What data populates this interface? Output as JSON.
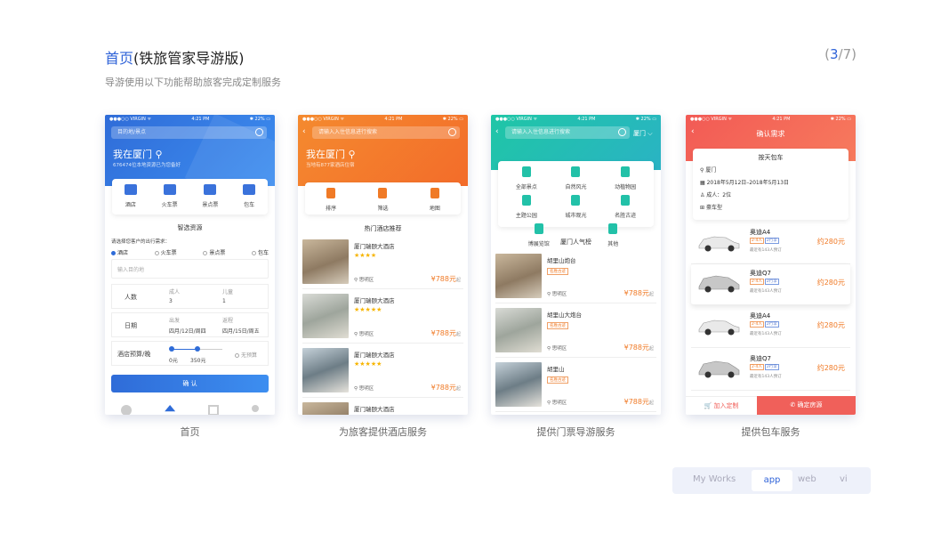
{
  "header": {
    "title_main": "首页",
    "title_rest": "(铁旅管家导游版)",
    "subtitle": "导游使用以下功能帮助旅客完成定制服务",
    "page_open": "(",
    "page_cur": "3",
    "page_rest": "/7)"
  },
  "status": {
    "carrier": "●●●○○ VIRGIN ᯤ",
    "time": "4:21 PM",
    "battery": "✱ 22% ▭"
  },
  "p1": {
    "search_placeholder": "目的地/景点",
    "location": "我在厦门",
    "location_sub": "676474位本地资源已为您备好",
    "cats": [
      "酒店",
      "火车票",
      "景点票",
      "包车"
    ],
    "section": "智选资源",
    "ask": "请选择您客户的出行需求：",
    "opts": [
      "酒店",
      "火车票",
      "景点票",
      "包车"
    ],
    "dest_placeholder": "输入目的地",
    "people_label": "人数",
    "adult_label": "成人",
    "adult_val": "3",
    "child_label": "儿童",
    "child_val": "1",
    "date_label": "日期",
    "depart_label": "出发",
    "depart_val": "四月/12日/周四",
    "return_label": "返程",
    "return_val": "四月/15日/周五",
    "budget_label": "酒店预算/晚",
    "budget_min": "0元",
    "budget_max": "350元",
    "budget_none": "无预算",
    "confirm": "确 认",
    "caption": "首页"
  },
  "p2": {
    "search_placeholder": "请输入入住信息进行搜索",
    "location": "我在厦门",
    "location_sub": "当地有877家酒店住宿",
    "cats": [
      "排序",
      "筛选",
      "地图"
    ],
    "section": "热门酒店推荐",
    "hotels": [
      {
        "name": "厦门瑞颐大酒店",
        "stars": "★★★★",
        "dist": "思明区",
        "price": "¥788元",
        "unit": "起"
      },
      {
        "name": "厦门瑞颐大酒店",
        "stars": "★★★★★",
        "dist": "思明区",
        "price": "¥788元",
        "unit": "起"
      },
      {
        "name": "厦门瑞颐大酒店",
        "stars": "★★★★★",
        "dist": "思明区",
        "price": "¥788元",
        "unit": "起"
      },
      {
        "name": "厦门瑞颐大酒店"
      }
    ],
    "caption": "为旅客提供酒店服务"
  },
  "p3": {
    "search_placeholder": "请输入入住信息进行搜索",
    "city": "厦门 ⌵",
    "cats": [
      "全部景点",
      "自然风光",
      "动植物园",
      "主题公园",
      "城市观光",
      "名胜古迹",
      "博展览馆",
      "其他"
    ],
    "section": "厦门人气榜",
    "spots": [
      {
        "name": "胡里山炮台",
        "tag": "名胜古迹",
        "dist": "思明区",
        "price": "¥788元",
        "unit": "起"
      },
      {
        "name": "胡里山大炮台",
        "tag": "名胜古迹",
        "dist": "思明区",
        "price": "¥788元",
        "unit": "起"
      },
      {
        "name": "胡里山",
        "tag": "名胜古迹",
        "dist": "思明区",
        "price": "¥788元",
        "unit": "起"
      }
    ],
    "caption": "提供门票导游服务"
  },
  "p4": {
    "header": "确认需求",
    "card_title": "按天包车",
    "city": "厦门",
    "dates": "2018年5月12日–2018年5月13日",
    "people": "成人：2位",
    "car_type": "豪车型",
    "cars": [
      {
        "name": "奥迪A4",
        "t1": "2-4人",
        "t2": "2行李",
        "sub": "最近有143人预订",
        "price": "约280元"
      },
      {
        "name": "奥迪Q7",
        "t1": "2-4人",
        "t2": "2行李",
        "sub": "最近有143人预订",
        "price": "约280元"
      },
      {
        "name": "奥迪A4",
        "t1": "2-4人",
        "t2": "2行李",
        "sub": "最近有143人预订",
        "price": "约280元"
      },
      {
        "name": "奥迪Q7",
        "t1": "2-4人",
        "t2": "2行李",
        "sub": "最近有143人预订",
        "price": "约280元"
      }
    ],
    "add": "加入定制",
    "confirm": "确定房源",
    "caption": "提供包车服务"
  },
  "tabs": {
    "works": "My Works",
    "app": "app",
    "web": "web",
    "vi": "vi"
  },
  "colors": {
    "blue": "#2f6cd8",
    "orange": "#f07a26",
    "teal": "#22c1a8",
    "red": "#f0605a"
  }
}
